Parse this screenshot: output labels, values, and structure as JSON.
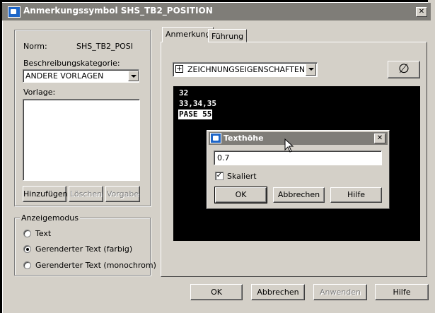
{
  "window": {
    "title": "Anmerkungssymbol SHS_TB2_POSITION",
    "close_glyph": "✕"
  },
  "left": {
    "norm_label": "Norm:",
    "norm_value": "SHS_TB2_POSI",
    "category_label": "Beschreibungskategorie:",
    "category_value": "ANDERE VORLAGEN",
    "template_label": "Vorlage:",
    "buttons": {
      "add": "Hinzufügen",
      "delete": "Löschen",
      "default": "Vorgabe"
    }
  },
  "display_mode": {
    "legend": "Anzeigemodus",
    "options": [
      {
        "label": "Text",
        "selected": false
      },
      {
        "label": "Gerenderter Text (farbig)",
        "selected": true
      },
      {
        "label": "Gerenderter Text (monochrom)",
        "selected": false
      }
    ]
  },
  "tabs": [
    {
      "label": "Anmerkung",
      "active": true
    },
    {
      "label": "Führung",
      "active": false
    }
  ],
  "annotation": {
    "properties_dropdown": "ZEICHNUNGSEIGENSCHAFTEN",
    "expand_glyph": "+",
    "diameter_glyph": "∅",
    "preview_lines": [
      "32",
      "33,34,35",
      "PASE 55"
    ]
  },
  "subdialog": {
    "title": "Texthöhe",
    "close_glyph": "✕",
    "value": "0.7",
    "scaled_label": "Skaliert",
    "scaled_checked": true,
    "check_glyph": "✓",
    "ok": "OK",
    "cancel": "Abbrechen",
    "help": "Hilfe"
  },
  "footer": {
    "ok": "OK",
    "cancel": "Abbrechen",
    "apply": "Anwenden",
    "help": "Hilfe"
  }
}
